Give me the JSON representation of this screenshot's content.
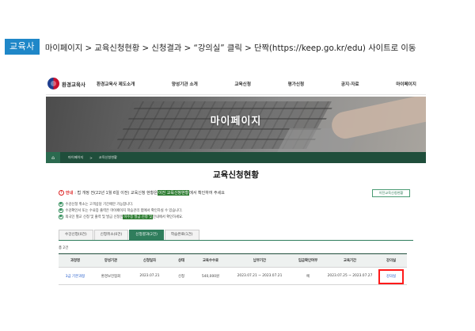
{
  "instruction": {
    "tag": "교육사",
    "text": "마이페이지 > 교육신청현황 > 신청결과 > “강의실” 클릭 > 단짝(https://keep.go.kr/edu) 사이트로 이동"
  },
  "site": {
    "logo_text": "환경교육사",
    "menu": [
      "환경교육사 제도소개",
      "양성기관 소개",
      "교육신청",
      "평가신청",
      "공지·자료",
      "마이페이지"
    ],
    "hero_title": "마이페이지",
    "breadcrumb": [
      "마이페이지",
      "교육신청현황"
    ],
    "page_title": "교육신청현황",
    "notice": {
      "label": "안내",
      "before": ": 법 개정 전(22년 1월 6일 이전) 교육신청 현황은 ",
      "highlight": "이전 교육신청현황",
      "after": "에서 확인하여 주세요"
    },
    "prev_button": "이전교육신청현황",
    "bullets": [
      "수강신청 취소는 고객상담 기간에만 가능합니다.",
      "수강확인서 또는 수료증 출력은 마이페이지 학습관리 탭에서 확인하실 수 있습니다.",
      "교육 이수 결과 및 출력 및 발급은 이수증 발급 신청 또는 안내에서 확인하세요."
    ],
    "bullet3_parts": {
      "before": "외국인 별교 신청 및 출력 및 발급 신청은 ",
      "highlight": "이수증 발급 신청 및",
      "after": " 안내에서 확인하세요."
    },
    "tabs": [
      "수강신청(0건)",
      "신청취소(0건)",
      "신청결과(2건)",
      "학습완료(1건)"
    ],
    "active_tab": "신청결과(2건)",
    "count": "총 2건",
    "table": {
      "headers": [
        "과정명",
        "양성기관",
        "신청일자",
        "상태",
        "교육수수료",
        "납부기간",
        "입금확인여부",
        "교육기간",
        "강의실"
      ],
      "rows": [
        [
          "3급 기본과정",
          "환경보전협회",
          "2023.07.21",
          "신청",
          "540,000원",
          "2023.07.21 ~ 2023.07.21",
          "예",
          "2023.07.25 ~ 2023.07.27",
          "강의실"
        ]
      ]
    }
  },
  "colors": {
    "tag_blue": "#1f87c8",
    "site_green": "#1f4e3b",
    "highlight_red": "#ff1a1a"
  }
}
